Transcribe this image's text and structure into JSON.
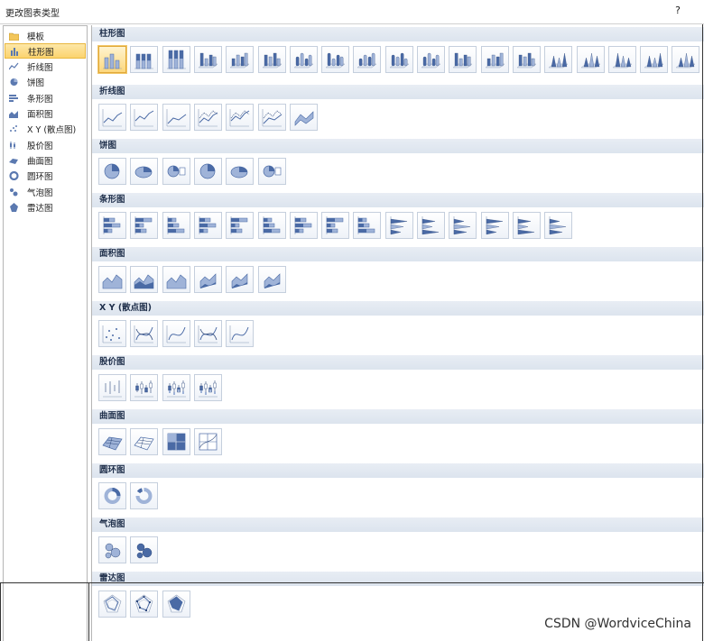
{
  "window": {
    "title": "更改图表类型",
    "help_label": "?"
  },
  "sidebar": {
    "items": [
      {
        "label": "模板",
        "icon": "folder-icon"
      },
      {
        "label": "柱形图",
        "icon": "column-chart-icon",
        "selected": true
      },
      {
        "label": "折线图",
        "icon": "line-chart-icon"
      },
      {
        "label": "饼图",
        "icon": "pie-chart-icon"
      },
      {
        "label": "条形图",
        "icon": "bar-chart-icon"
      },
      {
        "label": "面积图",
        "icon": "area-chart-icon"
      },
      {
        "label": "X Y (散点图)",
        "icon": "scatter-chart-icon"
      },
      {
        "label": "股价图",
        "icon": "stock-chart-icon"
      },
      {
        "label": "曲面图",
        "icon": "surface-chart-icon"
      },
      {
        "label": "圆环图",
        "icon": "doughnut-chart-icon"
      },
      {
        "label": "气泡图",
        "icon": "bubble-chart-icon"
      },
      {
        "label": "雷达图",
        "icon": "radar-chart-icon"
      }
    ]
  },
  "sections": [
    {
      "title": "柱形图",
      "kind": "column",
      "count": 19
    },
    {
      "title": "折线图",
      "kind": "line",
      "count": 7
    },
    {
      "title": "饼图",
      "kind": "pie",
      "count": 6
    },
    {
      "title": "条形图",
      "kind": "bar",
      "count": 15
    },
    {
      "title": "面积图",
      "kind": "area",
      "count": 6
    },
    {
      "title": "X Y (散点图)",
      "kind": "scatter",
      "count": 5
    },
    {
      "title": "股价图",
      "kind": "stock",
      "count": 4
    },
    {
      "title": "曲面图",
      "kind": "surface",
      "count": 4
    },
    {
      "title": "圆环图",
      "kind": "doughnut",
      "count": 2
    },
    {
      "title": "气泡图",
      "kind": "bubble",
      "count": 2
    },
    {
      "title": "雷达图",
      "kind": "radar",
      "count": 3
    }
  ],
  "colors": {
    "accent_blue": "#4a6aa5",
    "selection_orange": "#fbd36e"
  },
  "watermark": "CSDN @WordviceChina"
}
